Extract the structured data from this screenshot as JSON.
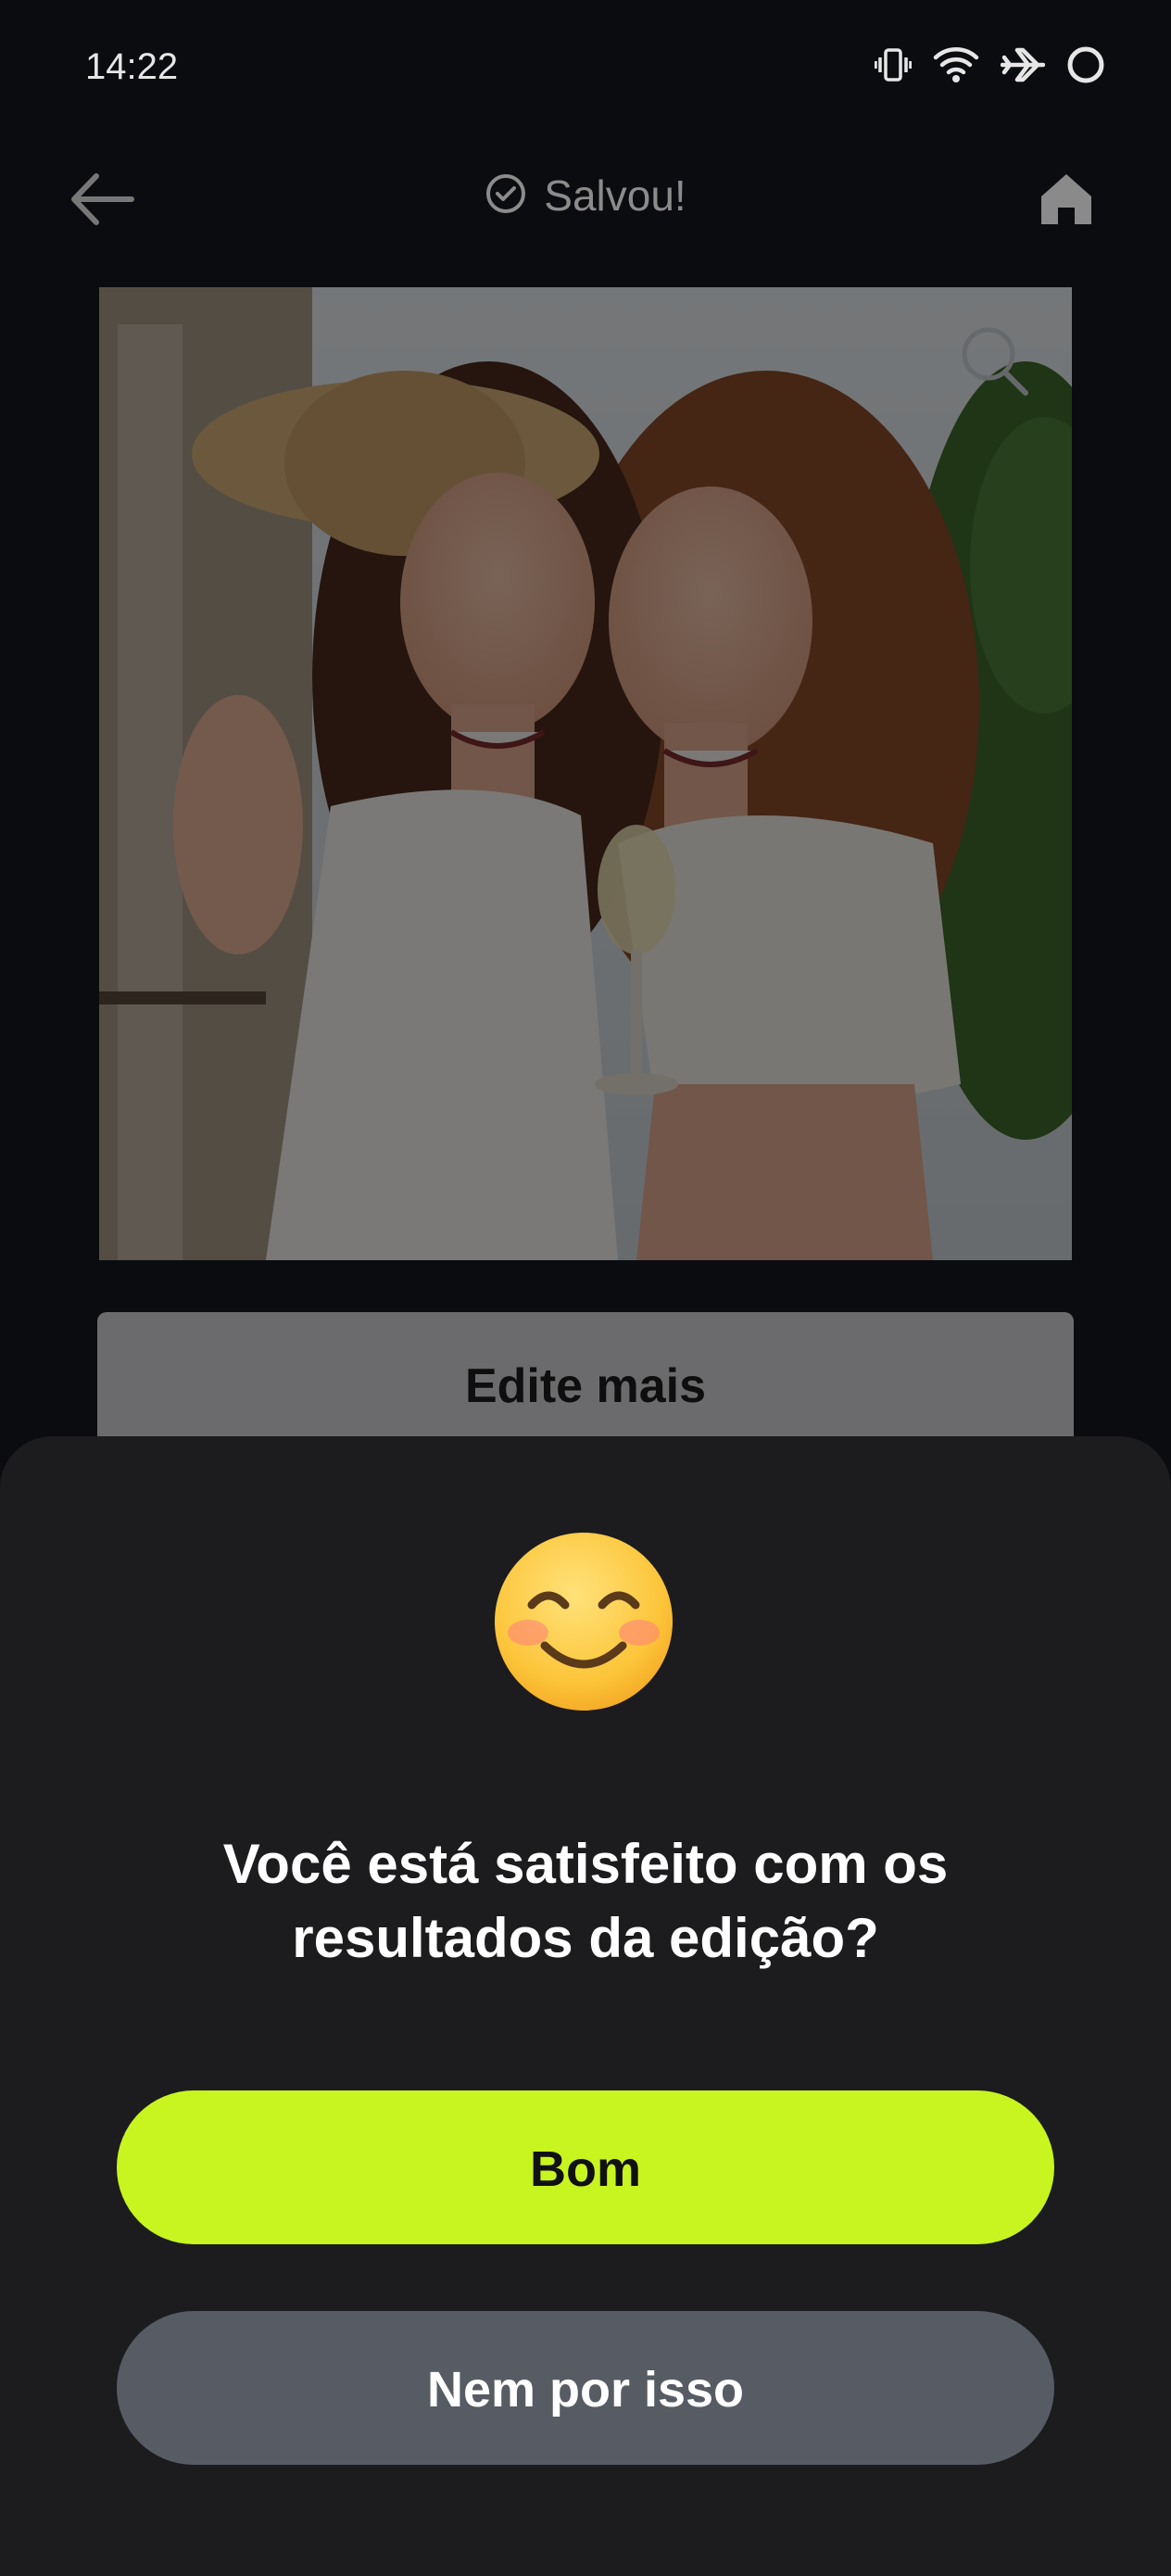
{
  "status_bar": {
    "time": "14:22",
    "icons": [
      "vibrate-icon",
      "wifi-icon",
      "airplane-icon",
      "loading-ring-icon"
    ]
  },
  "top_bar": {
    "back_icon": "arrow-left-icon",
    "saved_icon": "check-circle-icon",
    "saved_label": "Salvou!",
    "home_icon": "home-icon"
  },
  "photo": {
    "zoom_icon": "magnifier-icon"
  },
  "edit_more_label": "Edite mais",
  "feedback_sheet": {
    "emoji": "smiling-face-icon",
    "question_line1": "Você está satisfeito com os",
    "question_line2": "resultados da edição?",
    "good_label": "Bom",
    "bad_label": "Nem por isso"
  },
  "colors": {
    "accent": "#c8f51f",
    "secondary_button": "#575b64",
    "sheet_background": "#1c1c1e",
    "page_background": "#0b0c10"
  }
}
